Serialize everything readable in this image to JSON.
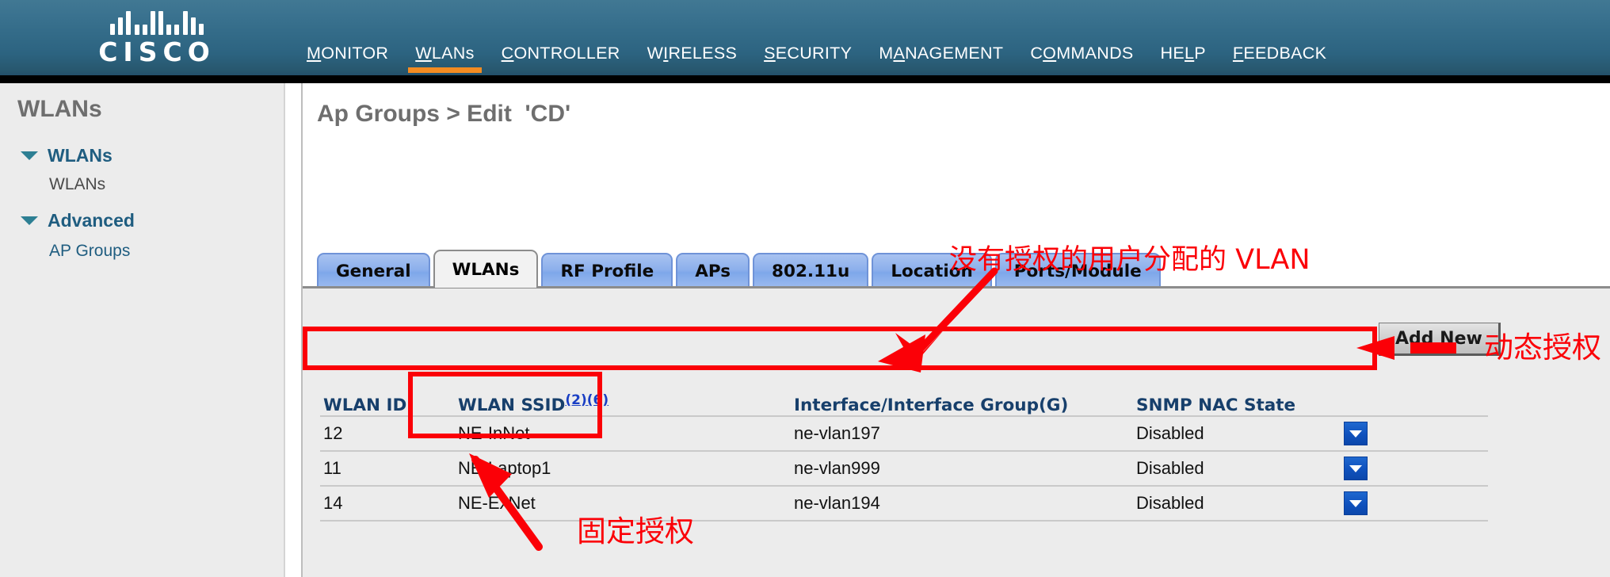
{
  "brand": {
    "wordmark": "CISCO",
    "logo_icon": "cisco-bars-logo"
  },
  "nav": {
    "items": [
      {
        "label": "MONITOR",
        "mnemonic": "M",
        "active": false
      },
      {
        "label": "WLANs",
        "mnemonic": "W",
        "active": true
      },
      {
        "label": "CONTROLLER",
        "mnemonic": "CO",
        "active": false
      },
      {
        "label": "WIRELESS",
        "mnemonic": "WI",
        "active": false
      },
      {
        "label": "SECURITY",
        "mnemonic": "S",
        "active": false
      },
      {
        "label": "MANAGEMENT",
        "mnemonic": "MA",
        "active": false
      },
      {
        "label": "COMMANDS",
        "mnemonic": "CO",
        "active": false
      },
      {
        "label": "HELP",
        "mnemonic": "HEL",
        "active": false
      },
      {
        "label": "FEEDBACK",
        "mnemonic": "F",
        "active": false
      }
    ]
  },
  "sidebar": {
    "title": "WLANs",
    "groups": [
      {
        "label": "WLANs",
        "icon": "triangle-down-icon",
        "children": [
          {
            "label": "WLANs"
          }
        ]
      },
      {
        "label": "Advanced",
        "icon": "triangle-down-icon",
        "children": [
          {
            "label": "AP Groups"
          }
        ]
      }
    ]
  },
  "main": {
    "page_title": "Ap Groups > Edit  'CD'",
    "tabs": [
      {
        "label": "General",
        "active": false
      },
      {
        "label": "WLANs",
        "active": true
      },
      {
        "label": "RF Profile",
        "active": false
      },
      {
        "label": "APs",
        "active": false
      },
      {
        "label": "802.11u",
        "active": false
      },
      {
        "label": "Location",
        "active": false
      },
      {
        "label": "Ports/Module",
        "active": false
      }
    ],
    "add_new_label": "Add New",
    "table": {
      "headers": {
        "wlan_id": "WLAN ID",
        "wlan_ssid": "WLAN SSID",
        "wlan_ssid_sup_1": "(2)",
        "wlan_ssid_sup_2": "(6)",
        "interface": "Interface/Interface Group(G)",
        "snmp_nac": "SNMP NAC State"
      },
      "rows": [
        {
          "wlan_id": "12",
          "ssid": "NE-InNet",
          "interface": "ne-vlan197",
          "nac_state": "Disabled",
          "action_icon": "dropdown-caret-icon"
        },
        {
          "wlan_id": "11",
          "ssid": "NE-Laptop1",
          "interface": "ne-vlan999",
          "nac_state": "Disabled",
          "action_icon": "dropdown-caret-icon"
        },
        {
          "wlan_id": "14",
          "ssid": "NE-ExNet",
          "interface": "ne-vlan194",
          "nac_state": "Disabled",
          "action_icon": "dropdown-caret-icon"
        }
      ]
    }
  },
  "annotations": {
    "unauthorized_vlan": "没有授权的用户分配的 VLAN",
    "dynamic_auth": "动态授权",
    "fixed_auth": "固定授权",
    "color": "#fb0007"
  },
  "colors": {
    "banner_top": "#417893",
    "banner_bottom": "#23506a",
    "accent_orange": "#f48b21",
    "sidebar_bg": "#ececec",
    "tab_blue": "#8db0ec",
    "header_text": "#173f6b",
    "dropdown_blue": "#0f51bd",
    "annotation_red": "#fb0007"
  }
}
